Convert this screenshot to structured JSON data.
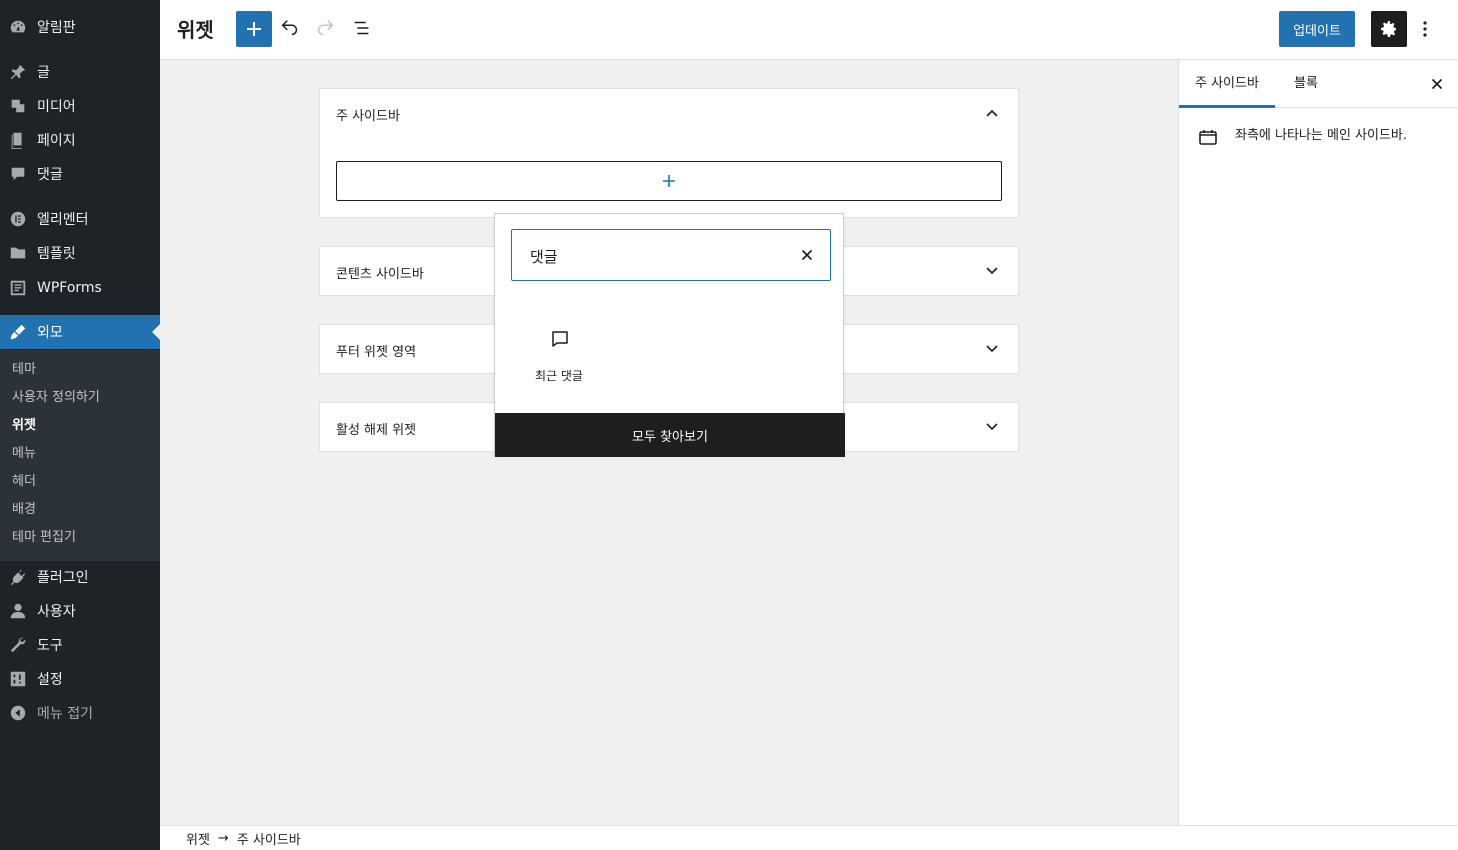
{
  "admin_menu": {
    "items": [
      {
        "label": "알림판",
        "icon": "dashboard-icon"
      },
      {
        "label": "글",
        "icon": "pin-icon"
      },
      {
        "label": "미디어",
        "icon": "media-icon"
      },
      {
        "label": "페이지",
        "icon": "page-icon"
      },
      {
        "label": "댓글",
        "icon": "comment-icon"
      },
      {
        "label": "엘리멘터",
        "icon": "elementor-icon"
      },
      {
        "label": "템플릿",
        "icon": "folder-icon"
      },
      {
        "label": "WPForms",
        "icon": "forms-icon"
      },
      {
        "label": "외모",
        "icon": "brush-icon"
      },
      {
        "label": "플러그인",
        "icon": "plugin-icon"
      },
      {
        "label": "사용자",
        "icon": "user-icon"
      },
      {
        "label": "도구",
        "icon": "wrench-icon"
      },
      {
        "label": "설정",
        "icon": "settings-icon"
      },
      {
        "label": "메뉴 접기",
        "icon": "collapse-icon"
      }
    ],
    "submenu": [
      "테마",
      "사용자 정의하기",
      "위젯",
      "메뉴",
      "헤더",
      "배경",
      "테마 편집기"
    ]
  },
  "topbar": {
    "title": "위젯",
    "update_label": "업데이트"
  },
  "settings_panel": {
    "tabs": [
      "주 사이드바",
      "블록"
    ],
    "description": "좌측에 나타나는 메인 사이드바."
  },
  "widget_areas": [
    {
      "title": "주 사이드바",
      "expanded": true
    },
    {
      "title": "콘텐츠 사이드바",
      "expanded": false
    },
    {
      "title": "푸터 위젯 영역",
      "expanded": false
    },
    {
      "title": "활성 해제 위젯",
      "expanded": false
    }
  ],
  "inserter": {
    "search_value": "댓글",
    "result_label": "최근 댓글",
    "browse_all_label": "모두 찾아보기"
  },
  "breadcrumb": {
    "root": "위젯",
    "separator": "→",
    "current": "주 사이드바"
  },
  "colors": {
    "accent": "#2271b1",
    "admin_bg": "#1d2327",
    "submenu_bg": "#2c3338",
    "dark": "#1e1e1e"
  }
}
